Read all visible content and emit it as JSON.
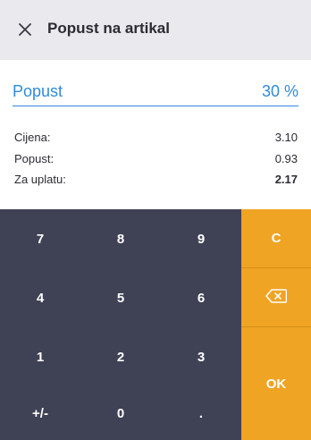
{
  "header": {
    "title": "Popust na artikal",
    "close_icon": "close-icon"
  },
  "discount": {
    "label": "Popust",
    "value": "30 %"
  },
  "summary": {
    "rows": [
      {
        "label": "Cijena:",
        "value": "3.10"
      },
      {
        "label": "Popust:",
        "value": "0.93"
      },
      {
        "label": "Za uplatu:",
        "value": "2.17"
      }
    ]
  },
  "keypad": {
    "keys": [
      "7",
      "8",
      "9",
      "4",
      "5",
      "6",
      "1",
      "2",
      "3",
      "+/-",
      "0",
      "."
    ],
    "clear_label": "C",
    "backspace_icon": "backspace-icon",
    "ok_label": "OK"
  },
  "colors": {
    "accent_blue": "#2f8bd8",
    "keypad_bg": "#3f4155",
    "keypad_orange": "#f0a423",
    "header_bg": "#e9e9ee"
  }
}
